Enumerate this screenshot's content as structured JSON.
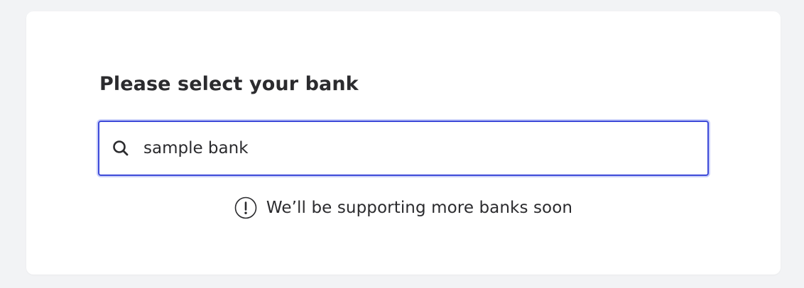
{
  "title": "Please select your bank",
  "search": {
    "value": "sample bank",
    "icon": "search-icon",
    "border_color": "#3d4ad8"
  },
  "notice": {
    "icon": "info-alert-icon",
    "text": "We’ll be supporting more banks soon"
  }
}
